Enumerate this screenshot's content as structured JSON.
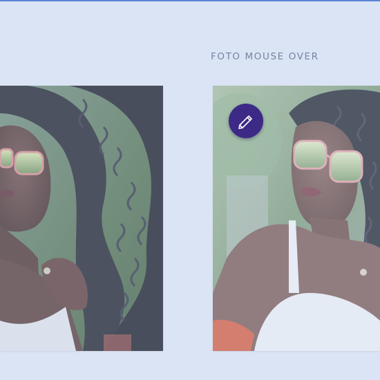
{
  "section": {
    "hover_label": "FOTO MOUSE OVER"
  },
  "colors": {
    "background": "#dfe8f5",
    "label_text": "#55637d",
    "edit_button": "#3d2a86",
    "top_rule": "#2e5fc9"
  },
  "icons": {
    "edit": "pencil-icon"
  }
}
